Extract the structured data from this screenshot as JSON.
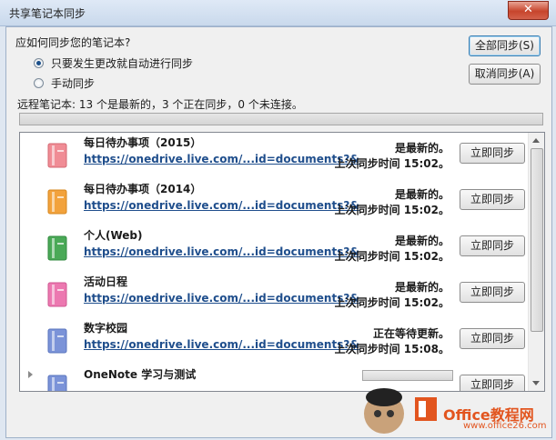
{
  "window": {
    "title": "共享笔记本同步",
    "close_label": "✕"
  },
  "prompt": {
    "question": "应如何同步您的笔记本?"
  },
  "options": [
    {
      "label": "只要发生更改就自动进行同步",
      "checked": true
    },
    {
      "label": "手动同步",
      "checked": false
    }
  ],
  "buttons": {
    "sync_all": "全部同步(S)",
    "cancel_sync": "取消同步(A)"
  },
  "summary": "远程笔记本: 13 个是最新的，3 个正在同步，0 个未连接。",
  "row_button_label": "立即同步",
  "notebooks": [
    {
      "name": "每日待办事项（2015）",
      "link": "https://onedrive.live.com/...id=documents?&",
      "status": "是最新的。",
      "time": "上次同步时间 15:02。",
      "color": "#f08c95"
    },
    {
      "name": "每日待办事项（2014）",
      "link": "https://onedrive.live.com/...id=documents?&",
      "status": "是最新的。",
      "time": "上次同步时间 15:02。",
      "color": "#f2a23c"
    },
    {
      "name": "个人(Web)",
      "link": "https://onedrive.live.com/...id=documents?&",
      "status": "是最新的。",
      "time": "上次同步时间 15:02。",
      "color": "#4aa957"
    },
    {
      "name": "活动日程",
      "link": "https://onedrive.live.com/...id=documents?&",
      "status": "是最新的。",
      "time": "上次同步时间 15:02。",
      "color": "#ec78b0"
    },
    {
      "name": "数字校园",
      "link": "https://onedrive.live.com/...id=documents?&",
      "status": "正在等待更新。",
      "time": "上次同步时间 15:08。",
      "color": "#7b93d8"
    },
    {
      "name": "OneNote 学习与测试",
      "link": "",
      "status": "",
      "time": "",
      "color": "#7b93d8"
    }
  ],
  "watermark": {
    "site1": "Office教程网",
    "site2": "www.office26.com"
  }
}
